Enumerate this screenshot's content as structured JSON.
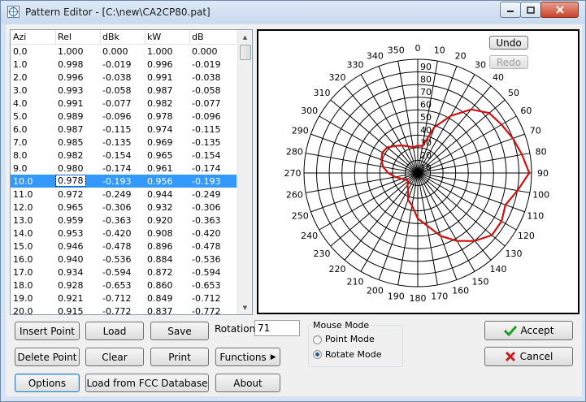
{
  "window": {
    "title": "Pattern Editor - [C:\\new\\CA2CP80.pat]"
  },
  "table": {
    "headers": [
      "Azi",
      "Rel",
      "dBk",
      "kW",
      "dB"
    ],
    "rows": [
      [
        "0.0",
        "1.000",
        "0.000",
        "1.000",
        "0.000"
      ],
      [
        "1.0",
        "0.998",
        "-0.019",
        "0.996",
        "-0.019"
      ],
      [
        "2.0",
        "0.996",
        "-0.038",
        "0.991",
        "-0.038"
      ],
      [
        "3.0",
        "0.993",
        "-0.058",
        "0.987",
        "-0.058"
      ],
      [
        "4.0",
        "0.991",
        "-0.077",
        "0.982",
        "-0.077"
      ],
      [
        "5.0",
        "0.989",
        "-0.096",
        "0.978",
        "-0.096"
      ],
      [
        "6.0",
        "0.987",
        "-0.115",
        "0.974",
        "-0.115"
      ],
      [
        "7.0",
        "0.985",
        "-0.135",
        "0.969",
        "-0.135"
      ],
      [
        "8.0",
        "0.982",
        "-0.154",
        "0.965",
        "-0.154"
      ],
      [
        "9.0",
        "0.980",
        "-0.174",
        "0.961",
        "-0.174"
      ],
      [
        "10.0",
        "0.978",
        "-0.193",
        "0.956",
        "-0.193"
      ],
      [
        "11.0",
        "0.972",
        "-0.249",
        "0.944",
        "-0.249"
      ],
      [
        "12.0",
        "0.965",
        "-0.306",
        "0.932",
        "-0.306"
      ],
      [
        "13.0",
        "0.959",
        "-0.363",
        "0.920",
        "-0.363"
      ],
      [
        "14.0",
        "0.953",
        "-0.420",
        "0.908",
        "-0.420"
      ],
      [
        "15.0",
        "0.946",
        "-0.478",
        "0.896",
        "-0.478"
      ],
      [
        "16.0",
        "0.940",
        "-0.536",
        "0.884",
        "-0.536"
      ],
      [
        "17.0",
        "0.934",
        "-0.594",
        "0.872",
        "-0.594"
      ],
      [
        "18.0",
        "0.928",
        "-0.653",
        "0.860",
        "-0.653"
      ],
      [
        "19.0",
        "0.921",
        "-0.712",
        "0.849",
        "-0.712"
      ],
      [
        "20.0",
        "0.915",
        "-0.772",
        "0.837",
        "-0.772"
      ]
    ],
    "selected_index": 10
  },
  "plot": {
    "undo_label": "Undo",
    "redo_label": "Redo",
    "azimuth_labels": [
      "0",
      "10",
      "20",
      "30",
      "40",
      "50",
      "60",
      "70",
      "80",
      "90",
      "100",
      "110",
      "120",
      "130",
      "140",
      "150",
      "160",
      "170",
      "180",
      "190",
      "200",
      "210",
      "220",
      "230",
      "240",
      "250",
      "260",
      "270",
      "280",
      "290",
      "300",
      "310",
      "320",
      "330",
      "340",
      "350"
    ],
    "radial_labels": [
      "90",
      "80",
      "70",
      "60",
      "50",
      "40",
      "30",
      "20",
      "10"
    ],
    "pattern_color": "#d01010"
  },
  "chart_data": {
    "type": "polar",
    "azimuth_deg": [
      0,
      10,
      20,
      30,
      40,
      50,
      60,
      70,
      80,
      90,
      100,
      110,
      120,
      130,
      140,
      150,
      160,
      170,
      180,
      190,
      200,
      210,
      220,
      230,
      240,
      250,
      260,
      270,
      280,
      290,
      300,
      310,
      320,
      330,
      340,
      350
    ],
    "relative_field": [
      0.24,
      0.24,
      0.43,
      0.58,
      0.73,
      0.82,
      0.85,
      0.89,
      0.93,
      0.98,
      0.89,
      0.82,
      0.85,
      0.85,
      0.78,
      0.69,
      0.59,
      0.47,
      0.4,
      0.29,
      0.25,
      0.17,
      0.14,
      0.11,
      0.12,
      0.15,
      0.2,
      0.26,
      0.31,
      0.34,
      0.36,
      0.35,
      0.31,
      0.28,
      0.25,
      0.23
    ],
    "radial_ticks": [
      90,
      80,
      70,
      60,
      50,
      40,
      30,
      20,
      10
    ],
    "grid": true
  },
  "controls": {
    "insert_point": "Insert Point",
    "load": "Load",
    "save": "Save",
    "rotation_label": "Rotation:",
    "rotation_value": "71",
    "delete_point": "Delete Point",
    "clear": "Clear",
    "print": "Print",
    "functions": "Functions",
    "options": "Options",
    "load_fcc": "Load from FCC Database",
    "about": "About",
    "mouse_mode_title": "Mouse Mode",
    "point_mode": "Point Mode",
    "rotate_mode": "Rotate Mode",
    "mouse_mode_selected": "rotate",
    "accept": "Accept",
    "cancel": "Cancel"
  },
  "colors": {
    "selection": "#3399ff",
    "accept_check": "#1f9d1f",
    "cancel_x": "#c81e1e"
  }
}
